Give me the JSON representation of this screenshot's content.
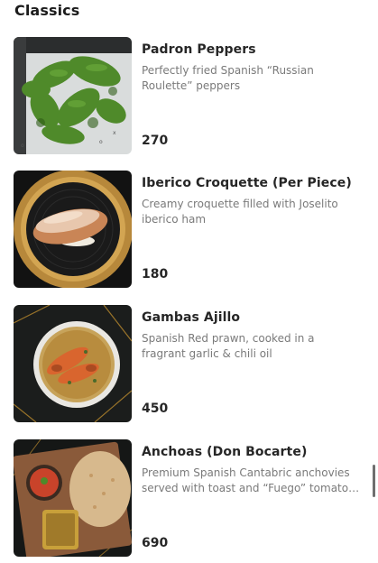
{
  "section": {
    "title": "Classics"
  },
  "items": [
    {
      "name": "Padron Peppers",
      "description": "Perfectly fried Spanish “Russian Roulette” peppers",
      "price": "270",
      "image_icon": "padron-peppers-photo"
    },
    {
      "name": "Iberico Croquette (Per Piece)",
      "description": "Creamy croquette filled with Joselito iberico ham",
      "price": "180",
      "image_icon": "croquette-photo"
    },
    {
      "name": "Gambas Ajillo",
      "description": "Spanish Red prawn, cooked in a fragrant garlic & chili oil",
      "price": "450",
      "image_icon": "gambas-photo"
    },
    {
      "name": "Anchoas (Don Bocarte)",
      "description": "Premium Spanish Cantabric anchovies served with toast and “Fuego” tomato sauce",
      "price": "690",
      "image_icon": "anchoas-photo"
    }
  ]
}
